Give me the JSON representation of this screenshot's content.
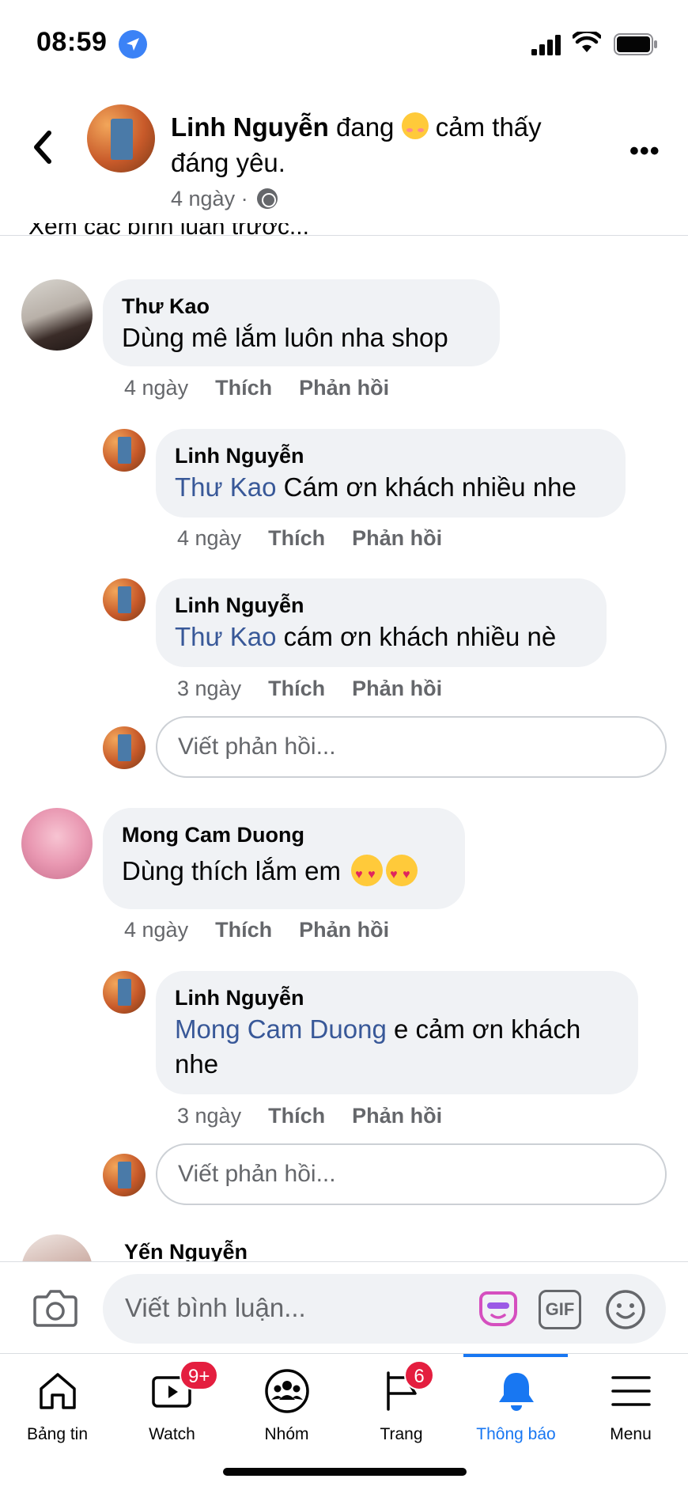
{
  "status_bar": {
    "time": "08:59"
  },
  "post_header": {
    "author": "Linh Nguyễn",
    "feeling_text": "đang",
    "feeling_value": "cảm thấy đáng yêu.",
    "time": "4 ngày",
    "separator": "·"
  },
  "previous_comments_link": "Xem các bình luận trước...",
  "comments": [
    {
      "author": "Thư Kao",
      "text": "Dùng mê lắm luôn nha shop",
      "time": "4 ngày",
      "like": "Thích",
      "reply": "Phản hồi",
      "replies": [
        {
          "author": "Linh Nguyễn",
          "tag": "Thư Kao",
          "text": "Cám ơn khách nhiều nhe",
          "time": "4 ngày",
          "like": "Thích",
          "reply": "Phản hồi"
        },
        {
          "author": "Linh Nguyễn",
          "tag": "Thư Kao",
          "text": "cám ơn khách nhiều nè",
          "time": "3 ngày",
          "like": "Thích",
          "reply": "Phản hồi"
        }
      ],
      "reply_placeholder": "Viết phản hồi..."
    },
    {
      "author": "Mong Cam Duong",
      "text": "Dùng thích lắm em",
      "time": "4 ngày",
      "like": "Thích",
      "reply": "Phản hồi",
      "replies": [
        {
          "author": "Linh Nguyễn",
          "tag": "Mong Cam Duong",
          "text": "e cảm ơn khách",
          "text_line2": "nhe",
          "time": "3 ngày",
          "like": "Thích",
          "reply": "Phản hồi"
        }
      ],
      "reply_placeholder": "Viết phản hồi..."
    },
    {
      "author": "Yến Nguyễn"
    }
  ],
  "composer": {
    "placeholder": "Viết bình luận...",
    "gif_label": "GIF"
  },
  "tabbar": {
    "tabs": [
      {
        "label": "Bảng tin",
        "icon": "home-icon"
      },
      {
        "label": "Watch",
        "icon": "watch-icon",
        "badge": "9+"
      },
      {
        "label": "Nhóm",
        "icon": "groups-icon"
      },
      {
        "label": "Trang",
        "icon": "flag-icon",
        "badge": "6"
      },
      {
        "label": "Thông báo",
        "icon": "bell-icon",
        "active": true
      },
      {
        "label": "Menu",
        "icon": "menu-icon"
      }
    ]
  },
  "colors": {
    "accent": "#1877f2",
    "tag": "#385898",
    "bubble": "#f0f2f5",
    "badge": "#e41e3f",
    "secondary_text": "#65676b"
  }
}
